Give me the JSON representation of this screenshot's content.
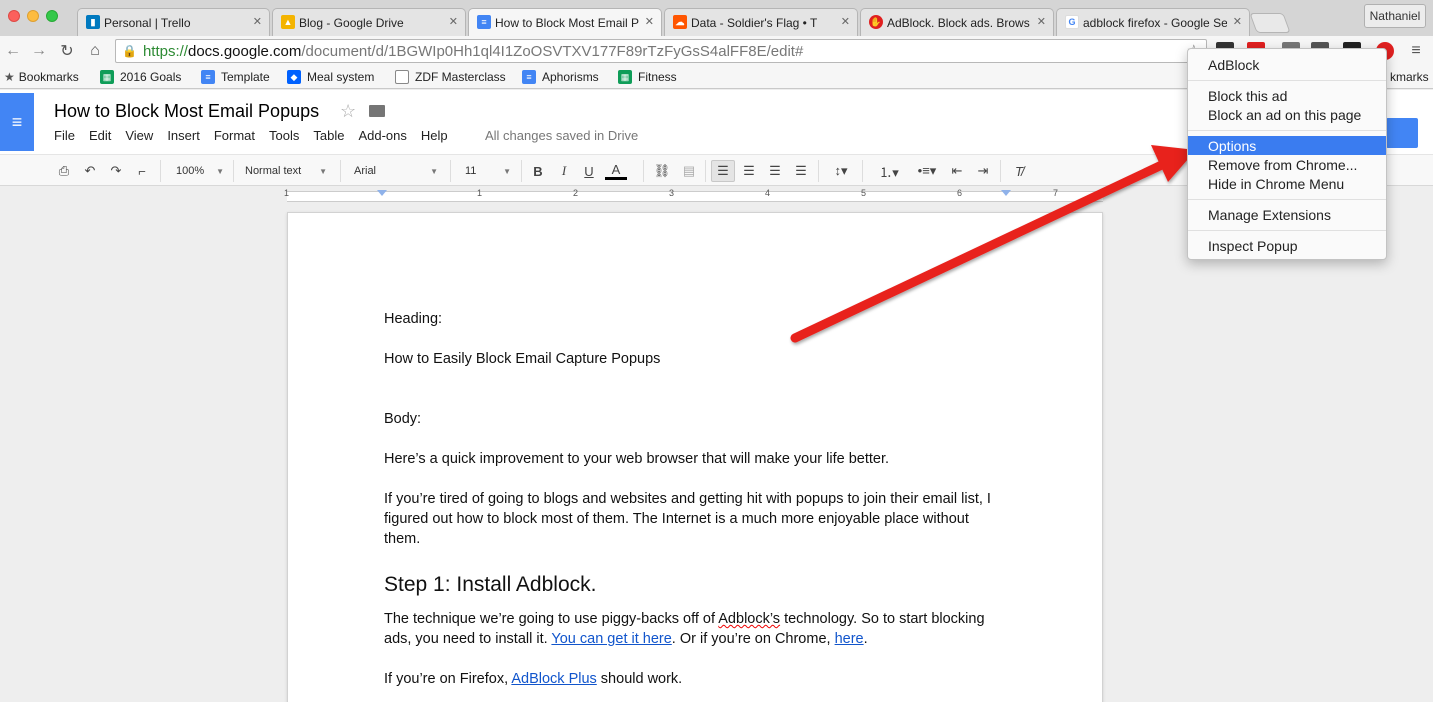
{
  "tabs": [
    {
      "label": "Personal | Trello",
      "icon": "trello-icon",
      "color": "#0079bf"
    },
    {
      "label": "Blog - Google Drive",
      "icon": "google-drive-icon",
      "color": "#f4b400"
    },
    {
      "label": "How to Block Most Email Po",
      "icon": "google-docs-icon",
      "color": "#4285f4",
      "active": true
    },
    {
      "label": "Data - Soldier's Flag • T",
      "icon": "soundcloud-icon",
      "color": "#ff5500"
    },
    {
      "label": "AdBlock. Block ads. Brows",
      "icon": "adblock-icon",
      "color": "#e02020"
    },
    {
      "label": "adblock firefox - Google Se",
      "icon": "google-icon",
      "color": "#4285f4"
    }
  ],
  "profile": {
    "name": "Nathaniel"
  },
  "address_bar": {
    "scheme": "https://",
    "host": "docs.google.com",
    "path": "/document/d/1BGWIp0Hh1ql4I1ZoOSVTXV177F89rTzFyGsS4alFF8E/edit#"
  },
  "bookmarks": {
    "root_label": "Bookmarks",
    "items": [
      {
        "label": "2016 Goals",
        "icon": "sheets-icon",
        "color": "#0f9d58"
      },
      {
        "label": "Template",
        "icon": "docs-icon",
        "color": "#4285f4"
      },
      {
        "label": "Meal system",
        "icon": "dropbox-icon",
        "color": "#0061fe"
      },
      {
        "label": "ZDF Masterclass",
        "icon": "page-icon",
        "color": "#888888"
      },
      {
        "label": "Aphorisms",
        "icon": "docs-icon",
        "color": "#4285f4"
      },
      {
        "label": "Fitness",
        "icon": "sheets-icon",
        "color": "#0f9d58"
      }
    ],
    "other_label_partial": "kmarks"
  },
  "doc": {
    "title": "How to Block Most Email Popups",
    "menu": [
      "File",
      "Edit",
      "View",
      "Insert",
      "Format",
      "Tools",
      "Table",
      "Add-ons",
      "Help"
    ],
    "save_status": "All changes saved in Drive"
  },
  "format_toolbar": {
    "zoom": "100%",
    "style": "Normal text",
    "font": "Arial",
    "size": "11"
  },
  "ruler": {
    "numbers": [
      "1",
      "1",
      "2",
      "3",
      "4",
      "5",
      "6",
      "7"
    ]
  },
  "content": {
    "heading_label": "Heading:",
    "heading_text": "How to Easily Block Email Capture Popups",
    "body_label": "Body:",
    "p1": "Here’s a quick improvement to your web browser that will make your life better.",
    "p2": "If you’re tired of going to blogs and websites and getting hit with popups to join their email list, I figured out how to block most of them. The Internet is a much more enjoyable place without them.",
    "step1": "Step 1: Install Adblock.",
    "p3_a": "The technique we’re going to use piggy-backs off of ",
    "p3_word": "Adblock’s",
    "p3_b": " technology. So to start blocking ads, you need to install it. ",
    "p3_link1": "You can get it here",
    "p3_c": ". Or if you’re on Chrome, ",
    "p3_link2": "here",
    "p3_d": ".",
    "p4_a": "If you’re on Firefox, ",
    "p4_link": "AdBlock Plus",
    "p4_b": " should work."
  },
  "context_menu": {
    "header": "AdBlock",
    "block_this": "Block this ad",
    "block_on_page": "Block an ad on this page",
    "options": "Options",
    "remove": "Remove from Chrome...",
    "hide": "Hide in Chrome Menu",
    "manage": "Manage Extensions",
    "inspect": "Inspect Popup"
  },
  "annotation": {
    "arrow_color": "#e8201c"
  }
}
